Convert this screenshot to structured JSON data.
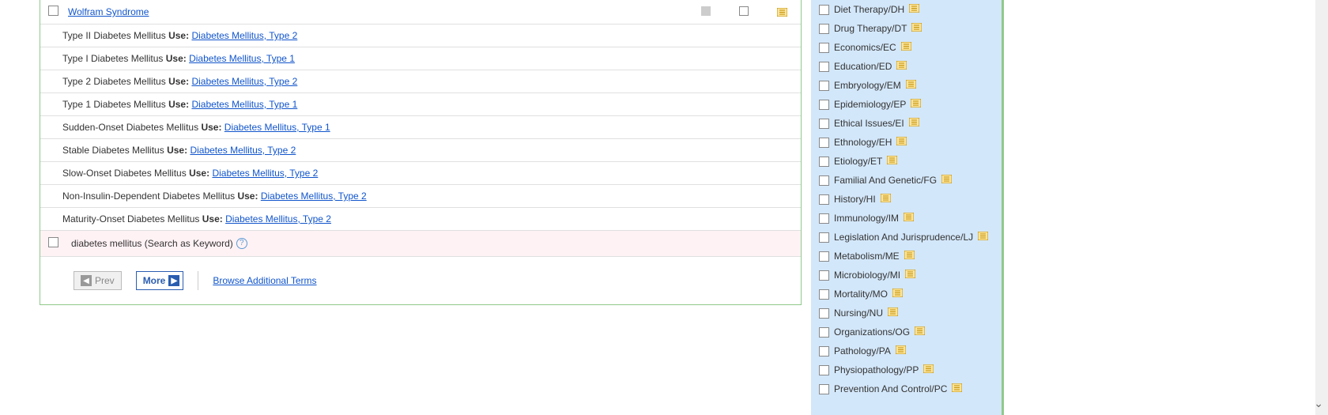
{
  "main": {
    "primary_row": {
      "label": "Wolfram Syndrome"
    },
    "use_rows": [
      {
        "term": "Type II Diabetes Mellitus",
        "use_label": "Use:",
        "target": "Diabetes Mellitus, Type 2"
      },
      {
        "term": "Type I Diabetes Mellitus",
        "use_label": "Use:",
        "target": "Diabetes Mellitus, Type 1"
      },
      {
        "term": "Type 2 Diabetes Mellitus",
        "use_label": "Use:",
        "target": "Diabetes Mellitus, Type 2"
      },
      {
        "term": "Type 1 Diabetes Mellitus",
        "use_label": "Use:",
        "target": "Diabetes Mellitus, Type 1"
      },
      {
        "term": "Sudden-Onset Diabetes Mellitus",
        "use_label": "Use:",
        "target": "Diabetes Mellitus, Type 1"
      },
      {
        "term": "Stable Diabetes Mellitus",
        "use_label": "Use:",
        "target": "Diabetes Mellitus, Type 2"
      },
      {
        "term": "Slow-Onset Diabetes Mellitus",
        "use_label": "Use:",
        "target": "Diabetes Mellitus, Type 2"
      },
      {
        "term": "Non-Insulin-Dependent Diabetes Mellitus",
        "use_label": "Use:",
        "target": "Diabetes Mellitus, Type 2"
      },
      {
        "term": "Maturity-Onset Diabetes Mellitus",
        "use_label": "Use:",
        "target": "Diabetes Mellitus, Type 2"
      }
    ],
    "keyword_row": {
      "text": "diabetes mellitus (Search as Keyword)"
    },
    "pager": {
      "prev": "Prev",
      "more": "More",
      "browse": "Browse Additional Terms"
    }
  },
  "sidebar": {
    "items": [
      {
        "label": "Diet Therapy/DH"
      },
      {
        "label": "Drug Therapy/DT"
      },
      {
        "label": "Economics/EC"
      },
      {
        "label": "Education/ED"
      },
      {
        "label": "Embryology/EM"
      },
      {
        "label": "Epidemiology/EP"
      },
      {
        "label": "Ethical Issues/EI"
      },
      {
        "label": "Ethnology/EH"
      },
      {
        "label": "Etiology/ET"
      },
      {
        "label": "Familial And Genetic/FG"
      },
      {
        "label": "History/HI"
      },
      {
        "label": "Immunology/IM"
      },
      {
        "label": "Legislation And Jurisprudence/LJ"
      },
      {
        "label": "Metabolism/ME"
      },
      {
        "label": "Microbiology/MI"
      },
      {
        "label": "Mortality/MO"
      },
      {
        "label": "Nursing/NU"
      },
      {
        "label": "Organizations/OG"
      },
      {
        "label": "Pathology/PA"
      },
      {
        "label": "Physiopathology/PP"
      },
      {
        "label": "Prevention And Control/PC"
      }
    ]
  }
}
